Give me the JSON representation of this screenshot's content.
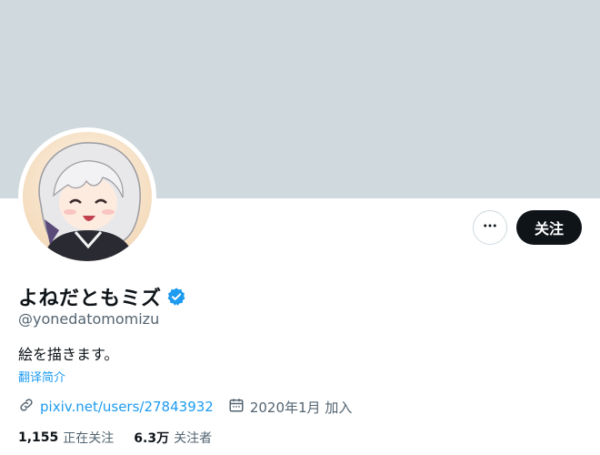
{
  "profile": {
    "display_name": "よねだともミズ",
    "handle": "@yonedatomomizu",
    "bio": "絵を描きます。",
    "translate_label": "翻译简介",
    "website": "pixiv.net/users/27843932",
    "joined": "2020年1月 加入",
    "following_count": "1,155",
    "following_label": "正在关注",
    "followers_count": "6.3万",
    "followers_label": "关注者"
  },
  "actions": {
    "follow_label": "关注",
    "more_icon": "more-horizontal-icon"
  },
  "icons": {
    "verified": "verified-badge-icon",
    "link": "link-icon",
    "calendar": "calendar-icon"
  },
  "colors": {
    "banner": "#cfd9de",
    "accent": "#1d9bf0",
    "text_primary": "#0f1419",
    "text_secondary": "#536471",
    "button_dark": "#0f1419"
  }
}
